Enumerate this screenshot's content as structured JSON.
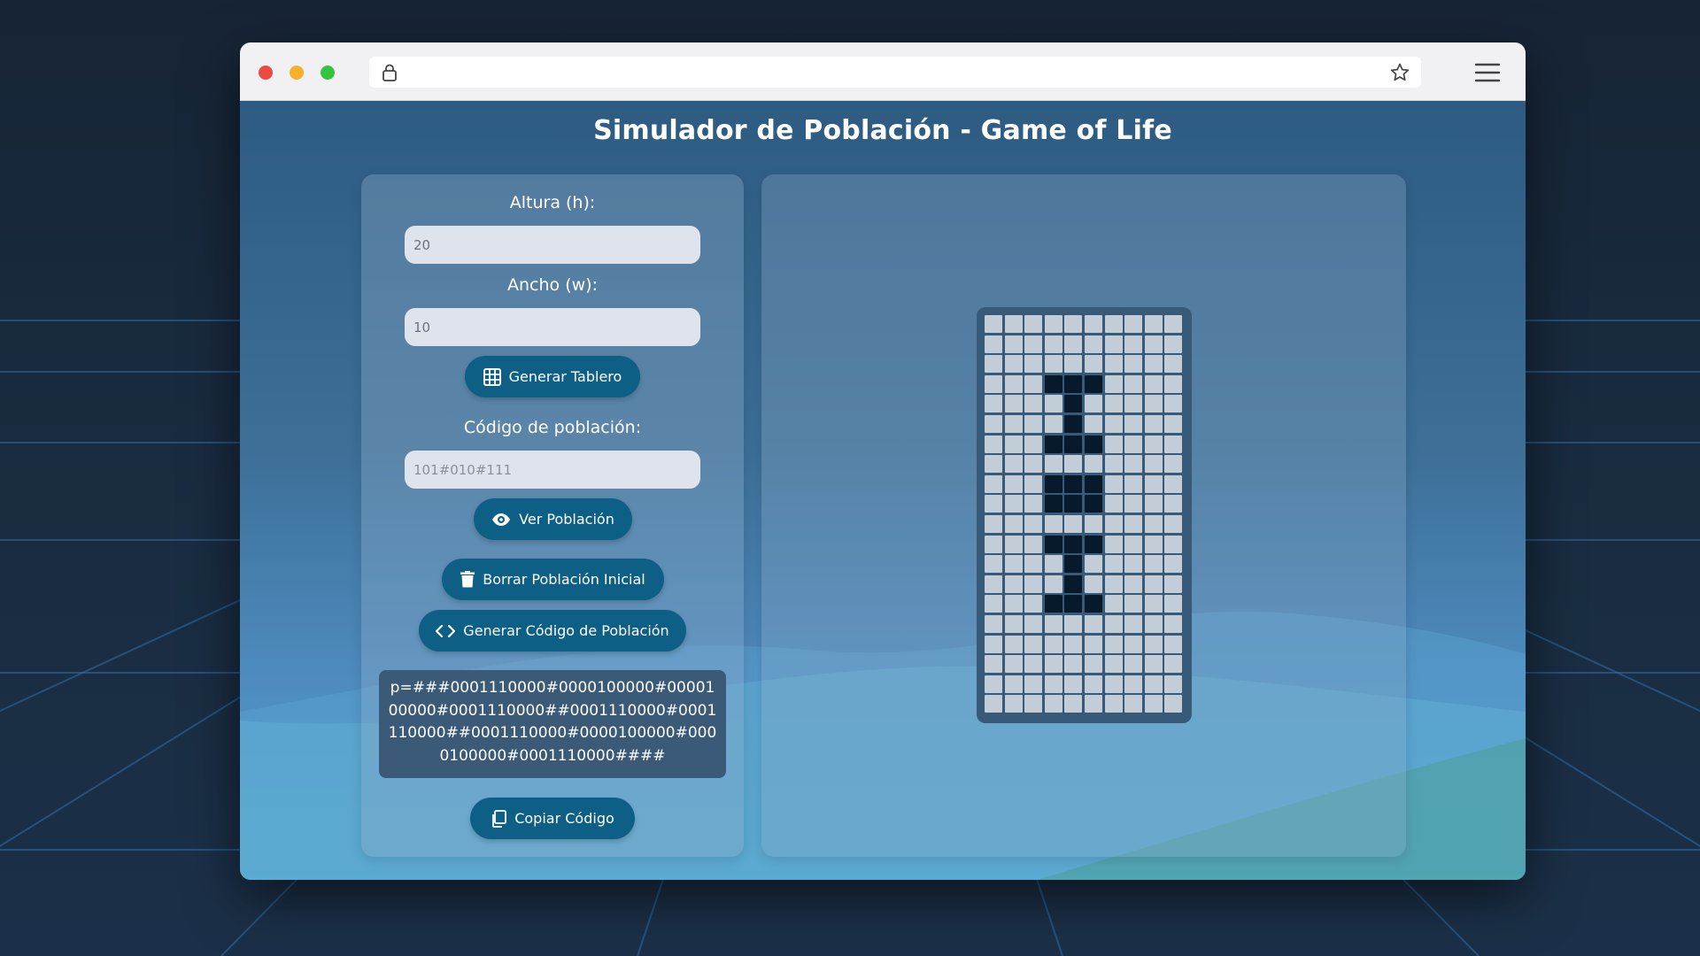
{
  "page": {
    "title": "Simulador de Población - Game of Life"
  },
  "controls": {
    "height_label": "Altura (h):",
    "height_value": "20",
    "width_label": "Ancho (w):",
    "width_value": "10",
    "generate_board_label": "Generar Tablero",
    "population_code_label": "Código de población:",
    "population_code_placeholder": "101#010#111",
    "view_population_label": "Ver Población",
    "clear_population_label": "Borrar Población Inicial",
    "generate_code_label": "Generar Código de Población",
    "generated_code": "p=###0001110000#0000100000#0000100000#0001110000##0001110000#0001110000##0001110000#0000100000#0000100000#0001110000####",
    "copy_code_label": "Copiar Código"
  },
  "board": {
    "rows": 20,
    "cols": 10,
    "alive_cells": [
      [
        3,
        3
      ],
      [
        3,
        4
      ],
      [
        3,
        5
      ],
      [
        4,
        4
      ],
      [
        5,
        4
      ],
      [
        6,
        3
      ],
      [
        6,
        4
      ],
      [
        6,
        5
      ],
      [
        8,
        3
      ],
      [
        8,
        4
      ],
      [
        8,
        5
      ],
      [
        9,
        3
      ],
      [
        9,
        4
      ],
      [
        9,
        5
      ],
      [
        11,
        3
      ],
      [
        11,
        4
      ],
      [
        11,
        5
      ],
      [
        12,
        4
      ],
      [
        13,
        4
      ],
      [
        14,
        3
      ],
      [
        14,
        4
      ],
      [
        14,
        5
      ]
    ]
  },
  "icons": {
    "lock": "lock-icon",
    "bookmark": "star-icon",
    "menu": "hamburger-menu-icon",
    "generate_board": "grid-icon",
    "view_population": "eye-icon",
    "clear_population": "trash-icon",
    "generate_code": "code-icon",
    "copy_code": "copy-icon"
  },
  "colors": {
    "button": "#0e5f86",
    "alive_cell": "#071a2b",
    "dead_cell": "#c3cdd8",
    "title": "#ffffff"
  }
}
